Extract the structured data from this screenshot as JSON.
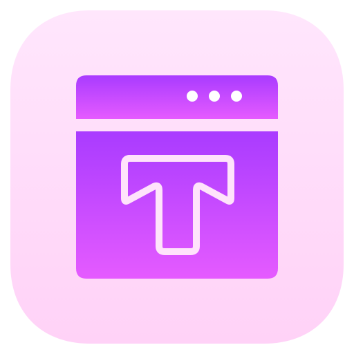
{
  "icon": {
    "name": "browser-text-tool-icon",
    "window_dots_count": 3,
    "colors": {
      "tile_top": "#FFE6FC",
      "tile_bottom": "#FFD2F7",
      "window_top": "#A93BFF",
      "window_bottom": "#E55BFF",
      "glyph_stroke": "#FFE3FB",
      "dot_color": "#FFFFFF"
    }
  }
}
